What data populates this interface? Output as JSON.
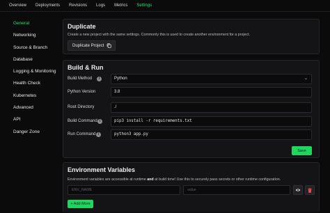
{
  "topnav": {
    "tabs": [
      {
        "label": "Overview"
      },
      {
        "label": "Deployments"
      },
      {
        "label": "Revisions"
      },
      {
        "label": "Logs"
      },
      {
        "label": "Metrics"
      },
      {
        "label": "Settings"
      }
    ],
    "active": "Settings"
  },
  "sidebar": {
    "items": [
      {
        "label": "General"
      },
      {
        "label": "Networking"
      },
      {
        "label": "Source & Branch"
      },
      {
        "label": "Database"
      },
      {
        "label": "Logging & Monitoring"
      },
      {
        "label": "Health Check"
      },
      {
        "label": "Kubernetes"
      },
      {
        "label": "Advanced"
      },
      {
        "label": "API"
      },
      {
        "label": "Danger Zone"
      }
    ],
    "active": "General"
  },
  "duplicate": {
    "title": "Duplicate",
    "description": "Create a new project with the same settings. Commonly this is used to create another environment for a project.",
    "button_label": "Duplicate Project",
    "button_icon": "copy-icon"
  },
  "build": {
    "title": "Build & Run",
    "fields": [
      {
        "label": "Build Method",
        "value": "Python"
      },
      {
        "label": "Python Version",
        "value": "3.8"
      },
      {
        "label": "Root Directory",
        "value": "./"
      },
      {
        "label": "Build Command",
        "value": "pip3 install -r requirements.txt"
      },
      {
        "label": "Run Command",
        "value": "python3 app.py"
      }
    ],
    "save_label": "Save"
  },
  "env": {
    "title": "Environment Variables",
    "desc_before": "Environment variables are accessible at runtime ",
    "desc_bold": "and",
    "desc_after": " at build time! Use this to securely pass secrets or other runtime configuration.",
    "name_placeholder": "ENV_NAME",
    "value_placeholder": "value",
    "add_label": "+ Add More"
  },
  "colors": {
    "accent": "#29e06b",
    "button_green": "#1fd660",
    "background": "#0b0b0c",
    "card": "#141416",
    "danger_icon": "#e5484d"
  }
}
